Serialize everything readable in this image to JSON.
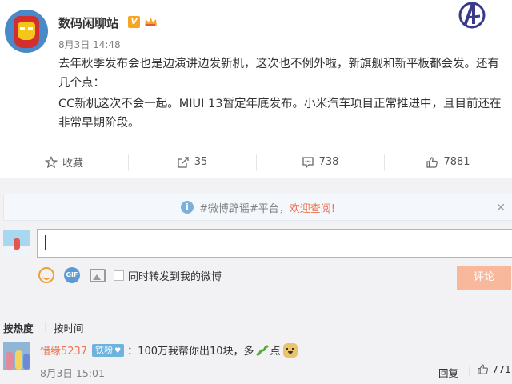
{
  "post": {
    "username": "数码闲聊站",
    "vbadge": "V",
    "time": "8月3日 14:48",
    "paragraphs": [
      "去年秋季发布会也是边演讲边发新机，这次也不例外啦，新旗舰和新平板都会发。还有几个点：",
      "CC新机这次不会一起。MIUI 13暂定年底发布。小米汽车项目正常推进中，且目前还在非常早期阶段。"
    ]
  },
  "actions": {
    "favorite": "收藏",
    "repost": "35",
    "comment": "738",
    "like": "7881"
  },
  "notice": {
    "prefix": "#微博辟谣#平台，",
    "link": "欢迎查阅!",
    "close": "✕"
  },
  "composer": {
    "input_value": "",
    "sync_label": "同时转发到我的微博",
    "submit_label": "评论",
    "gif_label": "GIF"
  },
  "sort": {
    "hot": "按热度",
    "separator": "|",
    "time": "按时间"
  },
  "comment": {
    "user": "惜缘5237",
    "fan_badge": "铁粉",
    "text_before": "：100万我帮你出10块，多",
    "text_after": "点",
    "time": "8月3日 15:01",
    "reply": "回复",
    "separator": "|",
    "likes": "771"
  },
  "colors": {
    "accent": "#eb7350",
    "submit_bg": "#f7b89c",
    "fan_badge": "#6db3de",
    "vbadge": "#f6a623"
  }
}
